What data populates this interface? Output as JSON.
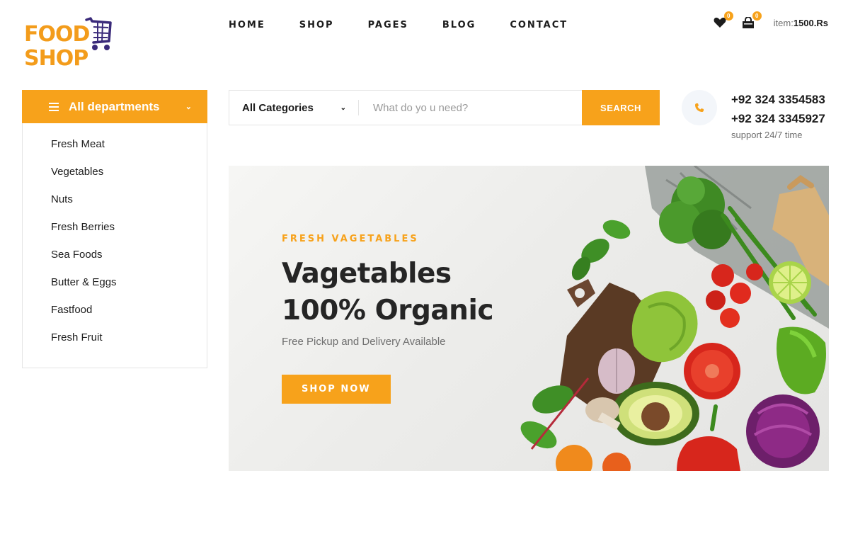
{
  "logo": {
    "line1": "FOOD",
    "line2": "SHOP"
  },
  "nav": [
    "HOME",
    "SHOP",
    "PAGES",
    "BLOG",
    "CONTACT"
  ],
  "header": {
    "wishlist_count": "0",
    "cart_count": "0",
    "item_label": "item:",
    "item_total": "1500.Rs"
  },
  "departments": {
    "title": "All departments",
    "items": [
      "Fresh Meat",
      "Vegetables",
      "Nuts",
      "Fresh Berries",
      "Sea Foods",
      "Butter & Eggs",
      "Fastfood",
      "Fresh Fruit"
    ]
  },
  "search": {
    "category": "All Categories",
    "placeholder": "What do yo u need?",
    "button": "SEARCH"
  },
  "contact": {
    "phone1": "+92 324 3354583",
    "phone2": "+92 324 3345927",
    "support": "support 24/7 time"
  },
  "hero": {
    "eyebrow": "FRESH VAGETABLES",
    "title_line1": "Vagetables",
    "title_line2": "100% Organic",
    "subtitle": "Free Pickup and Delivery Available",
    "button": "SHOP NOW"
  },
  "colors": {
    "accent": "#f7a21b",
    "text": "#1c1c1c",
    "muted": "#6f6f6f"
  }
}
